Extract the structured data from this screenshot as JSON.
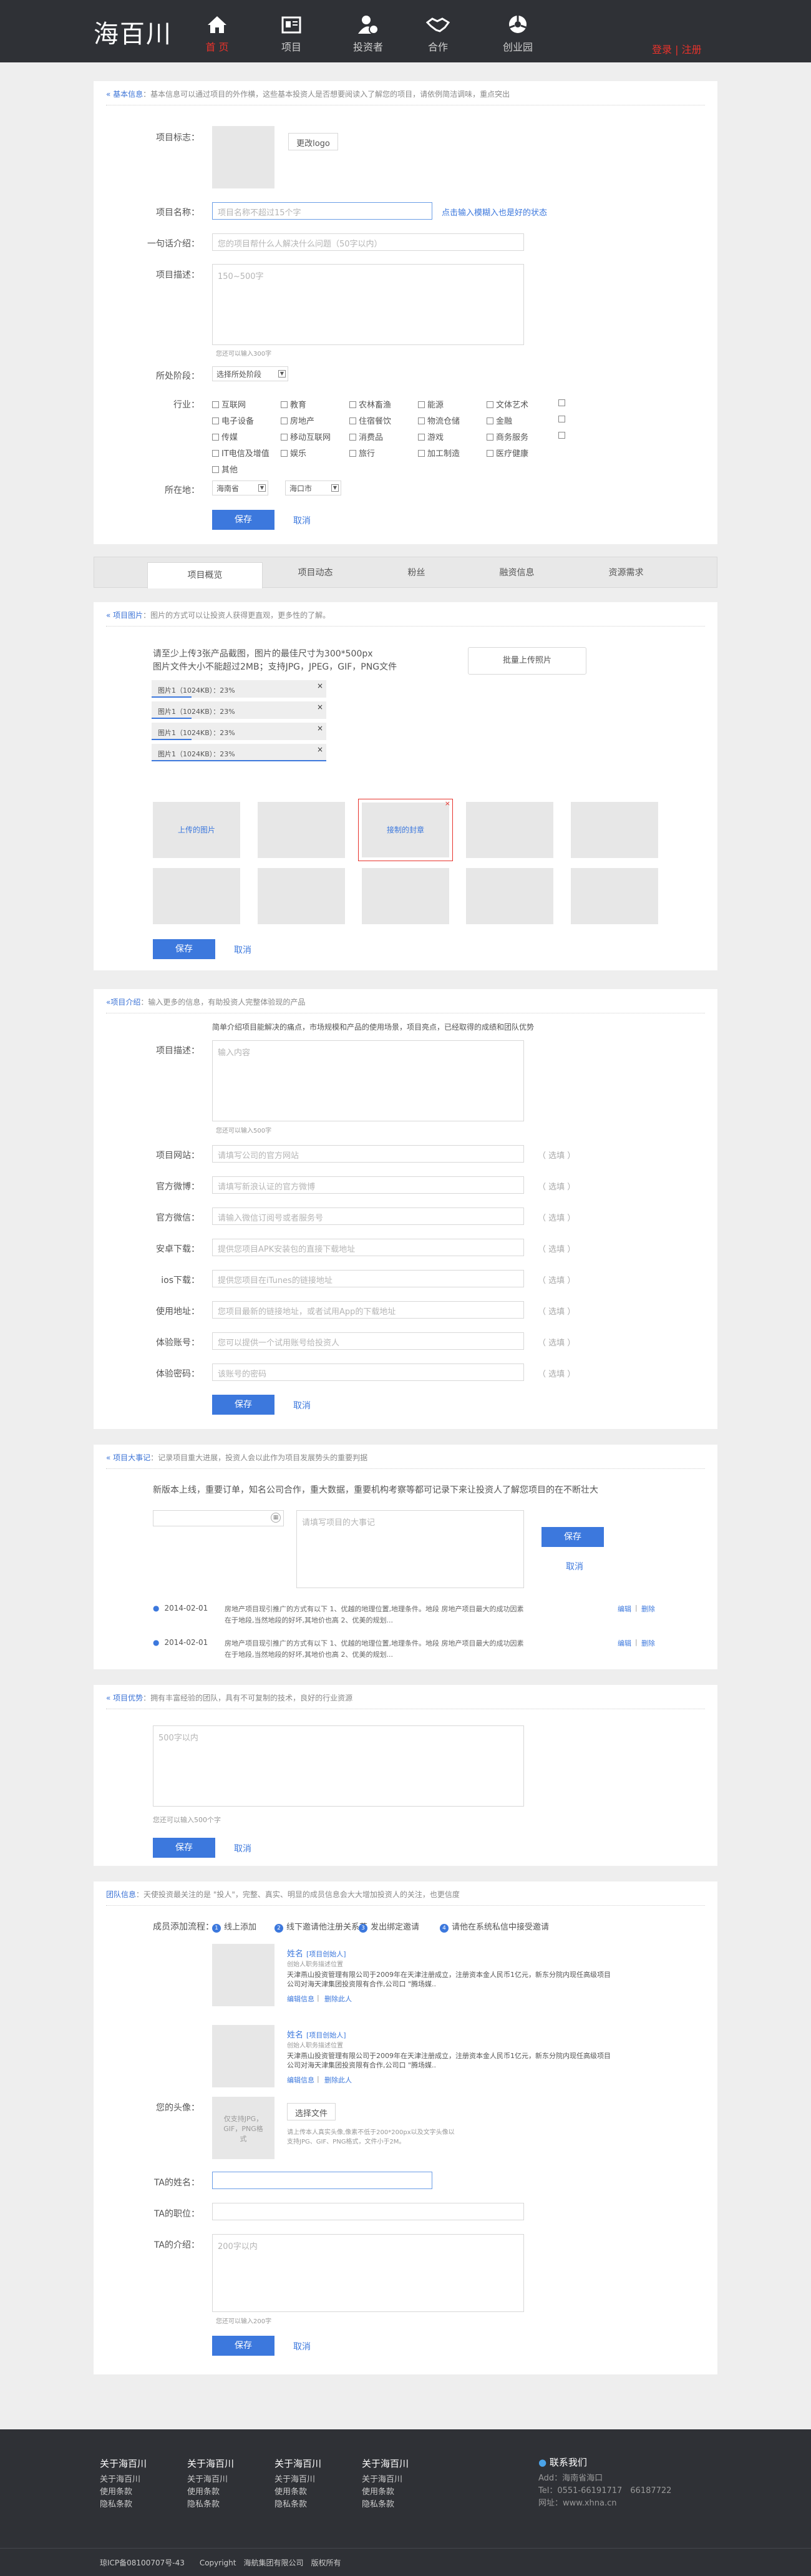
{
  "header": {
    "logo": "海百川",
    "nav": [
      {
        "label": "首 页",
        "icon": "home-icon"
      },
      {
        "label": "项目",
        "icon": "project-icon"
      },
      {
        "label": "投资者",
        "icon": "investor-icon"
      },
      {
        "label": "合作",
        "icon": "handshake-icon"
      },
      {
        "label": "创业园",
        "icon": "incubator-icon"
      }
    ],
    "login": "登录 | 注册"
  },
  "basic": {
    "head_tag": "« 基本信息",
    "head_text": "：基本信息可以通过项目的外作横，这些基本投资人是否想要阅读入了解您的项目，请依例简洁调味，重点突出",
    "logo_label": "项目标志：",
    "logo_btn": "更改logo",
    "name_label": "项目名称：",
    "name_placeholder": "项目名称不超过15个字",
    "name_link": "点击输入模糊入也是好的状态",
    "intro_label": "一句话介绍：",
    "intro_placeholder": "您的项目帮什么人解决什么问题（50字以内）",
    "desc_label": "项目描述：",
    "desc_placeholder": "150~500字",
    "desc_hint": "您还可以输入300字",
    "stage_label": "所处阶段：",
    "stage_value": "选择所处阶段",
    "industry_label": "行业：",
    "industries": [
      [
        "互联网",
        "教育",
        "农林畜渔",
        "能源",
        "文体艺术"
      ],
      [
        "电子设备",
        "房地产",
        "住宿餐饮",
        "物流仓储",
        "金融"
      ],
      [
        "传媒",
        "移动互联网",
        "消费品",
        "游戏",
        "商务服务"
      ],
      [
        "IT电信及增值",
        "娱乐",
        "旅行",
        "加工制造",
        "医疗健康"
      ],
      [
        "其他"
      ]
    ],
    "location_label": "所在地：",
    "province": "海南省",
    "city": "海口市",
    "save": "保存",
    "cancel": "取消"
  },
  "tabs": [
    "项目概览",
    "项目动态",
    "粉丝",
    "融资信息",
    "资源需求"
  ],
  "images": {
    "head_tag": "« 项目图片",
    "head_text": "：图片的方式可以让投资人获得更直观，更多性的了解。",
    "req1": "请至少上传3张产品截图，图片的最佳尺寸为300*500px",
    "req2": "图片文件大小不能超过2MB；支持JPG，JPEG，GIF，PNG文件",
    "batch_btn": "批量上传照片",
    "uploads": [
      {
        "text": "图片1（1024KB）：23%",
        "progress": 0.23
      },
      {
        "text": "图片1（1024KB）：23%",
        "progress": 0.23
      },
      {
        "text": "图片1（1024KB）：23%",
        "progress": 0.23
      },
      {
        "text": "图片1（1024KB）：23%",
        "progress": 0.23
      }
    ],
    "thumb_upload": "上传的图片",
    "thumb_cover": "接制的封章",
    "save": "保存",
    "cancel": "取消"
  },
  "project": {
    "head_tag": "«项目介绍",
    "head_text": "：输入更多的信息，有助投资人完整体验现的产品",
    "top_hint": "简单介绍项目能解决的痛点，市场规模和产品的使用场景，项目亮点，已经取得的成绩和团队优势",
    "desc_label": "项目描述：",
    "desc_placeholder": "输入内容",
    "desc_hint": "您还可以输入500字",
    "fields": [
      {
        "label": "项目网站：",
        "placeholder": "请填写公司的官方网站"
      },
      {
        "label": "官方微博：",
        "placeholder": "请填写新浪认证的官方微博"
      },
      {
        "label": "官方微信：",
        "placeholder": "请输入微信订阅号或者服务号"
      },
      {
        "label": "安卓下载：",
        "placeholder": "提供您项目APK安装包的直接下载地址"
      },
      {
        "label": "ios下载：",
        "placeholder": "提供您项目在iTunes的链接地址"
      },
      {
        "label": "使用地址：",
        "placeholder": "您项目最新的链接地址，或者试用App的下载地址"
      },
      {
        "label": "体验账号：",
        "placeholder": "您可以提供一个试用账号给投资人"
      },
      {
        "label": "体验密码：",
        "placeholder": "该账号的密码"
      }
    ],
    "optional": "（ 选填 ）",
    "save": "保存",
    "cancel": "取消"
  },
  "events": {
    "head_tag": "« 项目大事记",
    "head_text": "：记录项目重大进展，投资人会以此作为项目发展势头的重要判据",
    "intro": "新版本上线，重要订单，知名公司合作，重大数据，重要机构考察等都可记录下来让投资人了解您项目的在不断壮大",
    "textarea_placeholder": "请填写项目的大事记",
    "save": "保存",
    "cancel": "取消",
    "items": [
      {
        "date": "2014-02-01",
        "text": "房地产项目现引推广的方式有以下 1、优越的地理位置,地理条件。地段 房地产项目最大的成功因素在于地段,当然地段的好坏,其地价也高 2、优美的规划...",
        "edit": "编辑",
        "del": "删除"
      },
      {
        "date": "2014-02-01",
        "text": "房地产项目现引推广的方式有以下 1、优越的地理位置,地理条件。地段 房地产项目最大的成功因素在于地段,当然地段的好坏,其地价也高 2、优美的规划...",
        "edit": "编辑",
        "del": "删除"
      }
    ]
  },
  "advantage": {
    "head_tag": "« 项目优势",
    "head_text": "：拥有丰富经验的团队，具有不可复制的技术，良好的行业资源",
    "placeholder": "500字以内",
    "hint": "您还可以输入500个字",
    "save": "保存",
    "cancel": "取消"
  },
  "team": {
    "head_tag": "团队信息",
    "head_text": "：天使投资最关注的是 \"投人\"，完整、真实、明显的成员信息会大大增加投资人的关注，也更信度",
    "process_label": "成员添加流程：",
    "steps": [
      "线上添加",
      "线下邀请他注册关系艺",
      "发出绑定邀请",
      "请他在系统私信中接受邀请"
    ],
    "members": [
      {
        "name": "姓名",
        "role": "[项目创始人]",
        "sub": "创始人职务描述位置",
        "bio": "天津燕山投资管理有限公司于2009年在天津注册成立，注册资本金人民币1亿元，新东分院内现任高级项目公司对海天津集团投资限有合作,公司口 \"腾场媒..",
        "edit": "编辑信息",
        "del": "删除此人"
      },
      {
        "name": "姓名",
        "role": "[项目创始人]",
        "sub": "创始人职务描述位置",
        "bio": "天津燕山投资管理有限公司于2009年在天津注册成立，注册资本金人民币1亿元，新东分院内现任高级项目公司对海天津集团投资限有合作,公司口 \"腾场媒..",
        "edit": "编辑信息",
        "del": "删除此人"
      }
    ],
    "avatar_label": "您的头像：",
    "avatar_box": "仅支持JPG，GIF，PNG格式",
    "choose_btn": "选择文件",
    "avatar_hint1": "请上传本人真实头像,像素不低于200*200px以及文字头像以",
    "avatar_hint2": "支持JPG、GIF、PNG格式，文件小于2M。",
    "name_label": "TA的姓名：",
    "title_label": "TA的职位：",
    "intro_label": "TA的介绍：",
    "intro_placeholder": "200字以内",
    "intro_hint": "您还可以输入200字",
    "save": "保存",
    "cancel": "取消"
  },
  "footer": {
    "cols": [
      {
        "h": "关于海百川",
        "items": [
          "关于海百川",
          "使用条款",
          "隐私条款"
        ]
      },
      {
        "h": "关于海百川",
        "items": [
          "关于海百川",
          "使用条款",
          "隐私条款"
        ]
      },
      {
        "h": "关于海百川",
        "items": [
          "关于海百川",
          "使用条款",
          "隐私条款"
        ]
      },
      {
        "h": "关于海百川",
        "items": [
          "关于海百川",
          "使用条款",
          "隐私条款"
        ]
      }
    ],
    "contact_h": "联系我们",
    "contact": [
      "Add：海南省海口",
      "Tel：0551-66191717　66187722",
      "网址：www.xhna.cn"
    ],
    "bottom": "琼ICP备08100707号-43　　Copyright　海航集团有限公司　版权所有"
  }
}
